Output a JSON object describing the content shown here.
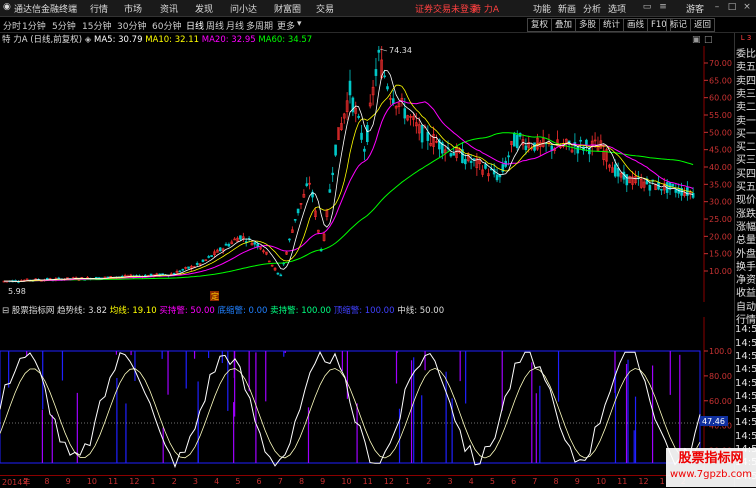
{
  "topbar": {
    "app_name": "通达信金融终端",
    "menus": [
      "行情",
      "市场",
      "资讯",
      "发现",
      "问小达",
      "财富圈",
      "交易"
    ],
    "notice": "证券交易未登录",
    "stock_tag": "特 力A",
    "right_menus": [
      "功能",
      "新画",
      "分析",
      "选项"
    ],
    "guest": "游客"
  },
  "periodbar": {
    "tabs": [
      "分时",
      "1分钟",
      "5分钟",
      "15分钟",
      "30分钟",
      "60分钟",
      "日线",
      "周线",
      "月线",
      "多周期",
      "更多"
    ],
    "active": "日线",
    "right_buttons": [
      "复权",
      "叠加",
      "多股",
      "统计",
      "画线",
      "F10",
      "标记",
      "返回"
    ]
  },
  "main_header": {
    "title": "特 力A (日线,前复权)",
    "ma5": "MA5: 30.79",
    "ma10": "MA10: 32.11",
    "ma20": "MA20: 32.95",
    "ma60": "MA60: 34.57",
    "peak_label": "74.34",
    "low_label": "5.98",
    "marker": "定"
  },
  "main_yaxis": [
    "70.00",
    "65.00",
    "60.00",
    "55.00",
    "50.00",
    "45.00",
    "40.00",
    "35.00",
    "30.00",
    "25.00",
    "20.00",
    "15.00",
    "10.00"
  ],
  "sub_header": {
    "name": "股票指标网",
    "trend": "趋势线: 3.82",
    "avg": "均线: 19.10",
    "buy": "买持警: 50.00",
    "shrink": "底缩警: 0.00",
    "sell": "卖持警: 100.00",
    "topdiv": "顶缩警: 100.00",
    "mid": "中线: 50.00"
  },
  "sub_yaxis": [
    "100.0",
    "80.00",
    "60.00",
    "40.00",
    "20.00"
  ],
  "sub_current": "47.46",
  "xaxis": [
    "2014年",
    "7",
    "8",
    "9",
    "10",
    "11",
    "12",
    "1",
    "2",
    "3",
    "4",
    "5",
    "6",
    "7",
    "8",
    "9",
    "10",
    "11",
    "12",
    "1",
    "2",
    "3",
    "4",
    "5",
    "6",
    "7",
    "8",
    "9",
    "10",
    "11",
    "12",
    "1",
    "2"
  ],
  "right_panel": {
    "header": "L 3",
    "items": [
      "委比",
      "卖五",
      "卖四",
      "卖三",
      "卖二",
      "卖一",
      "买一",
      "买二",
      "买三",
      "买四",
      "买五",
      "现价",
      "涨跌",
      "涨幅",
      "总量",
      "外盘",
      "换手",
      "净资",
      "收益",
      "自动",
      "行情",
      "14:5",
      "14:5",
      "14:5",
      "14:5",
      "14:5",
      "14:5",
      "14:5",
      "14:5",
      "14:5",
      "14:5",
      "14:5",
      "14:5"
    ]
  },
  "watermark": {
    "line1": "股票指标网",
    "line2": "www.7gpzb.com"
  },
  "colors": {
    "up": "#ff3030",
    "down": "#00c8c8",
    "ma5": "#ffffff",
    "ma10": "#ffff00",
    "ma20": "#ff00ff",
    "ma60": "#00ff00",
    "axis": "#c83232",
    "blue": "#2020ff",
    "purple": "#a000ff"
  }
}
